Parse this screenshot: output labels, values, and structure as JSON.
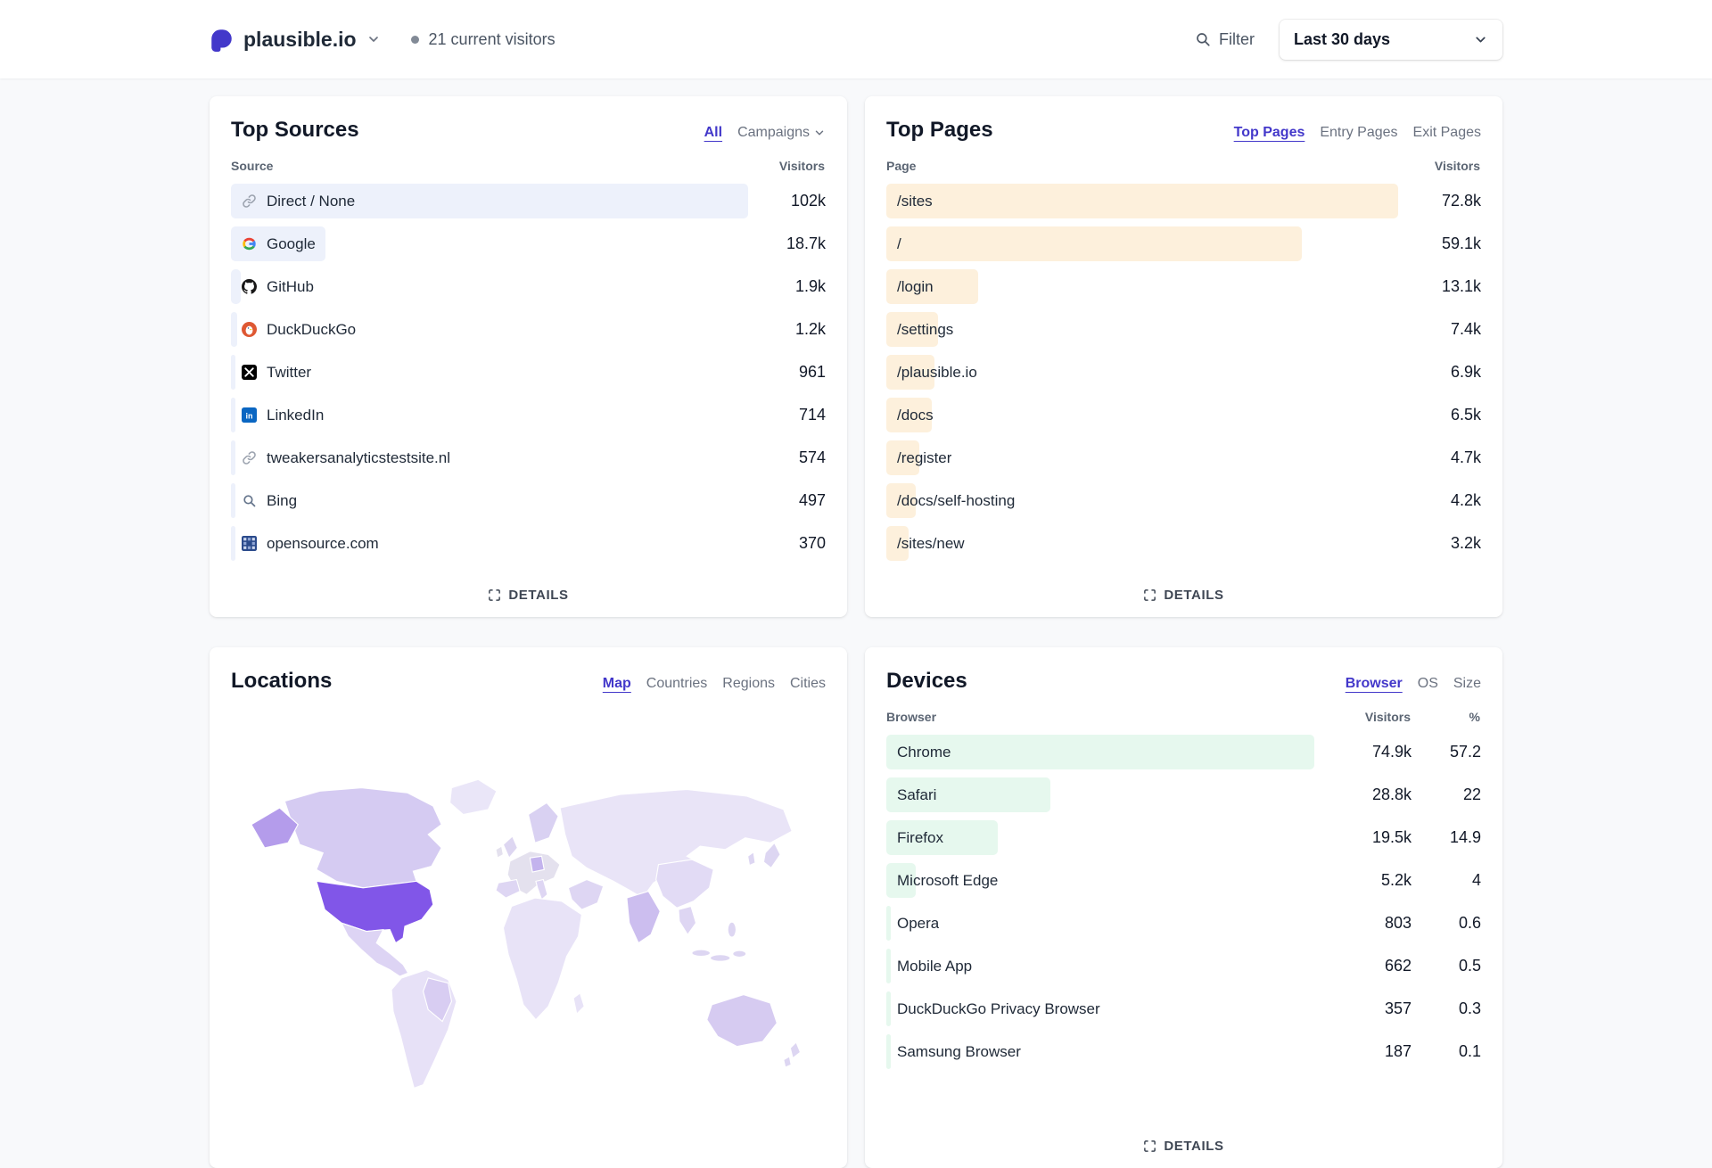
{
  "theme": {
    "accent": "#4338ca",
    "sources_bar": "#edf1fb",
    "pages_bar": "#fdf0dc",
    "devices_bar": "#e6f8ee",
    "map_low": "#e9e4f7",
    "map_mid": "#cfc2ef",
    "map_high": "#8156e8",
    "map_nodata": "#e4e1ee"
  },
  "header": {
    "site_name": "plausible.io",
    "current_visitors": "21 current visitors",
    "filter_label": "Filter",
    "date_range": "Last 30 days"
  },
  "top_sources": {
    "title": "Top Sources",
    "tabs": [
      {
        "label": "All",
        "active": true
      },
      {
        "label": "Campaigns",
        "active": false,
        "chevron": true
      }
    ],
    "columns": {
      "label": "Source",
      "value": "Visitors"
    },
    "details_label": "DETAILS",
    "rows": [
      {
        "label": "Direct / None",
        "icon": "link",
        "value": "102k",
        "bar_pct": 100
      },
      {
        "label": "Google",
        "icon": "google",
        "value": "18.7k",
        "bar_pct": 18.3
      },
      {
        "label": "GitHub",
        "icon": "github",
        "value": "1.9k",
        "bar_pct": 1.9
      },
      {
        "label": "DuckDuckGo",
        "icon": "duckduckgo",
        "value": "1.2k",
        "bar_pct": 1.2
      },
      {
        "label": "Twitter",
        "icon": "twitter-x",
        "value": "961",
        "bar_pct": 0.9
      },
      {
        "label": "LinkedIn",
        "icon": "linkedin",
        "value": "714",
        "bar_pct": 0.7
      },
      {
        "label": "tweakersanalyticstestsite.nl",
        "icon": "link",
        "value": "574",
        "bar_pct": 0.6
      },
      {
        "label": "Bing",
        "icon": "bing",
        "value": "497",
        "bar_pct": 0.5
      },
      {
        "label": "opensource.com",
        "icon": "opensource",
        "value": "370",
        "bar_pct": 0.4
      }
    ]
  },
  "top_pages": {
    "title": "Top Pages",
    "tabs": [
      {
        "label": "Top Pages",
        "active": true
      },
      {
        "label": "Entry Pages",
        "active": false
      },
      {
        "label": "Exit Pages",
        "active": false
      }
    ],
    "columns": {
      "label": "Page",
      "value": "Visitors"
    },
    "details_label": "DETAILS",
    "rows": [
      {
        "label": "/sites",
        "value": "72.8k",
        "bar_pct": 100
      },
      {
        "label": "/",
        "value": "59.1k",
        "bar_pct": 81.2
      },
      {
        "label": "/login",
        "value": "13.1k",
        "bar_pct": 18.0
      },
      {
        "label": "/settings",
        "value": "7.4k",
        "bar_pct": 10.2
      },
      {
        "label": "/plausible.io",
        "value": "6.9k",
        "bar_pct": 9.5
      },
      {
        "label": "/docs",
        "value": "6.5k",
        "bar_pct": 8.9
      },
      {
        "label": "/register",
        "value": "4.7k",
        "bar_pct": 6.5
      },
      {
        "label": "/docs/self-hosting",
        "value": "4.2k",
        "bar_pct": 5.8
      },
      {
        "label": "/sites/new",
        "value": "3.2k",
        "bar_pct": 4.4
      }
    ]
  },
  "locations": {
    "title": "Locations",
    "tabs": [
      {
        "label": "Map",
        "active": true
      },
      {
        "label": "Countries",
        "active": false
      },
      {
        "label": "Regions",
        "active": false
      },
      {
        "label": "Cities",
        "active": false
      }
    ]
  },
  "devices": {
    "title": "Devices",
    "tabs": [
      {
        "label": "Browser",
        "active": true
      },
      {
        "label": "OS",
        "active": false
      },
      {
        "label": "Size",
        "active": false
      }
    ],
    "columns": {
      "label": "Browser",
      "value": "Visitors",
      "pct": "%"
    },
    "details_label": "DETAILS",
    "rows": [
      {
        "label": "Chrome",
        "value": "74.9k",
        "pct": "57.2",
        "bar_pct": 100
      },
      {
        "label": "Safari",
        "value": "28.8k",
        "pct": "22",
        "bar_pct": 38.4
      },
      {
        "label": "Firefox",
        "value": "19.5k",
        "pct": "14.9",
        "bar_pct": 26.0
      },
      {
        "label": "Microsoft Edge",
        "value": "5.2k",
        "pct": "4",
        "bar_pct": 6.9
      },
      {
        "label": "Opera",
        "value": "803",
        "pct": "0.6",
        "bar_pct": 1.1
      },
      {
        "label": "Mobile App",
        "value": "662",
        "pct": "0.5",
        "bar_pct": 0.9
      },
      {
        "label": "DuckDuckGo Privacy Browser",
        "value": "357",
        "pct": "0.3",
        "bar_pct": 0.5
      },
      {
        "label": "Samsung Browser",
        "value": "187",
        "pct": "0.1",
        "bar_pct": 0.25
      }
    ]
  }
}
